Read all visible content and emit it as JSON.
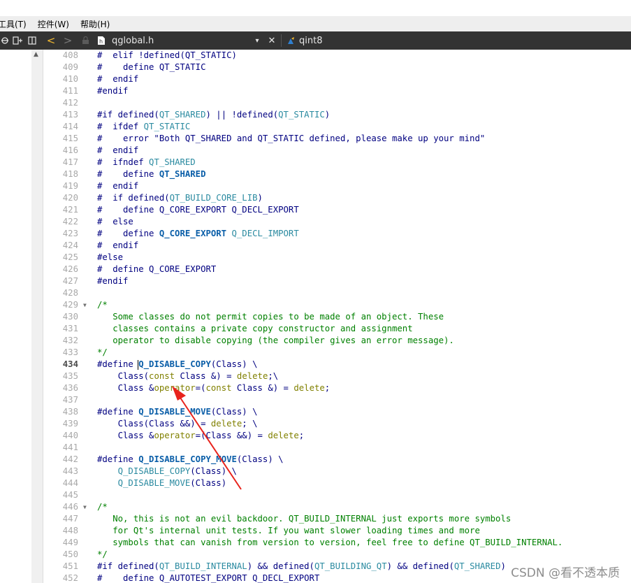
{
  "menu": [
    "工具(T)",
    "控件(W)",
    "帮助(H)"
  ],
  "toolbar": {
    "file_name": "qglobal.h",
    "symbol": "qint8",
    "back_glyph": "<",
    "forward_glyph": ">",
    "dropdown_glyph": "▾",
    "close_glyph": "✕"
  },
  "editor": {
    "current_line": 434,
    "lines": [
      {
        "n": "408",
        "t": [
          [
            "pp",
            "#  elif !defined(QT_STATIC)"
          ]
        ]
      },
      {
        "n": "409",
        "t": [
          [
            "pp",
            "#    define QT_STATIC"
          ]
        ]
      },
      {
        "n": "410",
        "t": [
          [
            "pp",
            "#  endif"
          ]
        ]
      },
      {
        "n": "411",
        "t": [
          [
            "pp",
            "#endif"
          ]
        ]
      },
      {
        "n": "412",
        "t": []
      },
      {
        "n": "413",
        "t": [
          [
            "pp",
            "#if defined("
          ],
          [
            "call",
            "QT_SHARED"
          ],
          [
            "pp",
            ") || !defined("
          ],
          [
            "call",
            "QT_STATIC"
          ],
          [
            "pp",
            ")"
          ]
        ]
      },
      {
        "n": "414",
        "t": [
          [
            "pp",
            "#  ifdef "
          ],
          [
            "call",
            "QT_STATIC"
          ]
        ]
      },
      {
        "n": "415",
        "t": [
          [
            "pp",
            "#    error \"Both QT_SHARED and QT_STATIC defined, please make up your mind\""
          ]
        ]
      },
      {
        "n": "416",
        "t": [
          [
            "pp",
            "#  endif"
          ]
        ]
      },
      {
        "n": "417",
        "t": [
          [
            "pp",
            "#  ifndef "
          ],
          [
            "call",
            "QT_SHARED"
          ]
        ]
      },
      {
        "n": "418",
        "t": [
          [
            "pp",
            "#    define "
          ],
          [
            "macro",
            "QT_SHARED"
          ]
        ]
      },
      {
        "n": "419",
        "t": [
          [
            "pp",
            "#  endif"
          ]
        ]
      },
      {
        "n": "420",
        "t": [
          [
            "pp",
            "#  if defined("
          ],
          [
            "call",
            "QT_BUILD_CORE_LIB"
          ],
          [
            "pp",
            ")"
          ]
        ]
      },
      {
        "n": "421",
        "t": [
          [
            "pp",
            "#    define Q_CORE_EXPORT Q_DECL_EXPORT"
          ]
        ]
      },
      {
        "n": "422",
        "t": [
          [
            "pp",
            "#  else"
          ]
        ]
      },
      {
        "n": "423",
        "t": [
          [
            "pp",
            "#    define "
          ],
          [
            "macro",
            "Q_CORE_EXPORT"
          ],
          [
            "pp",
            " "
          ],
          [
            "call",
            "Q_DECL_IMPORT"
          ]
        ]
      },
      {
        "n": "424",
        "t": [
          [
            "pp",
            "#  endif"
          ]
        ]
      },
      {
        "n": "425",
        "t": [
          [
            "pp",
            "#else"
          ]
        ]
      },
      {
        "n": "426",
        "t": [
          [
            "pp",
            "#  define Q_CORE_EXPORT"
          ]
        ]
      },
      {
        "n": "427",
        "t": [
          [
            "pp",
            "#endif"
          ]
        ]
      },
      {
        "n": "428",
        "t": []
      },
      {
        "n": "429",
        "f": true,
        "t": [
          [
            "comment",
            "/*"
          ]
        ]
      },
      {
        "n": "430",
        "t": [
          [
            "comment",
            "   Some classes do not permit copies to be made of an object. These"
          ]
        ]
      },
      {
        "n": "431",
        "t": [
          [
            "comment",
            "   classes contains a private copy constructor and assignment"
          ]
        ]
      },
      {
        "n": "432",
        "t": [
          [
            "comment",
            "   operator to disable copying (the compiler gives an error message)."
          ]
        ]
      },
      {
        "n": "433",
        "t": [
          [
            "comment",
            "*/"
          ]
        ]
      },
      {
        "n": "434",
        "t": [
          [
            "pp",
            "#define "
          ],
          [
            "caret",
            ""
          ],
          [
            "macro",
            "Q_DISABLE_COPY"
          ],
          [
            "pp",
            "(Class) \\"
          ]
        ]
      },
      {
        "n": "435",
        "t": [
          [
            "pp",
            "    Class("
          ],
          [
            "kw",
            "const"
          ],
          [
            "pp",
            " Class &) = "
          ],
          [
            "kw",
            "delete"
          ],
          [
            "pp",
            ";\\"
          ]
        ]
      },
      {
        "n": "436",
        "t": [
          [
            "pp",
            "    Class &"
          ],
          [
            "kw",
            "operator"
          ],
          [
            "pp",
            "=("
          ],
          [
            "kw",
            "const"
          ],
          [
            "pp",
            " Class &) = "
          ],
          [
            "kw",
            "delete"
          ],
          [
            "pp",
            ";"
          ]
        ]
      },
      {
        "n": "437",
        "t": []
      },
      {
        "n": "438",
        "t": [
          [
            "pp",
            "#define "
          ],
          [
            "macro",
            "Q_DISABLE_MOVE"
          ],
          [
            "pp",
            "(Class) \\"
          ]
        ]
      },
      {
        "n": "439",
        "t": [
          [
            "pp",
            "    Class(Class &&) = "
          ],
          [
            "kw",
            "delete"
          ],
          [
            "pp",
            "; \\"
          ]
        ]
      },
      {
        "n": "440",
        "t": [
          [
            "pp",
            "    Class &"
          ],
          [
            "kw",
            "operator"
          ],
          [
            "pp",
            "=(Class &&) = "
          ],
          [
            "kw",
            "delete"
          ],
          [
            "pp",
            ";"
          ]
        ]
      },
      {
        "n": "441",
        "t": []
      },
      {
        "n": "442",
        "t": [
          [
            "pp",
            "#define "
          ],
          [
            "macro",
            "Q_DISABLE_COPY_MOVE"
          ],
          [
            "pp",
            "(Class) \\"
          ]
        ]
      },
      {
        "n": "443",
        "t": [
          [
            "pp",
            "    "
          ],
          [
            "call",
            "Q_DISABLE_COPY"
          ],
          [
            "pp",
            "(Class) \\"
          ]
        ]
      },
      {
        "n": "444",
        "t": [
          [
            "pp",
            "    "
          ],
          [
            "call",
            "Q_DISABLE_MOVE"
          ],
          [
            "pp",
            "(Class)"
          ]
        ]
      },
      {
        "n": "445",
        "t": []
      },
      {
        "n": "446",
        "f": true,
        "t": [
          [
            "comment",
            "/*"
          ]
        ]
      },
      {
        "n": "447",
        "t": [
          [
            "comment",
            "   No, this is not an evil backdoor. QT_BUILD_INTERNAL just exports more symbols"
          ]
        ]
      },
      {
        "n": "448",
        "t": [
          [
            "comment",
            "   for Qt's internal unit tests. If you want slower loading times and more"
          ]
        ]
      },
      {
        "n": "449",
        "t": [
          [
            "comment",
            "   symbols that can vanish from version to version, feel free to define QT_BUILD_INTERNAL."
          ]
        ]
      },
      {
        "n": "450",
        "t": [
          [
            "comment",
            "*/"
          ]
        ]
      },
      {
        "n": "451",
        "t": [
          [
            "pp",
            "#if defined("
          ],
          [
            "call",
            "QT_BUILD_INTERNAL"
          ],
          [
            "pp",
            ") && defined("
          ],
          [
            "call",
            "QT_BUILDING_QT"
          ],
          [
            "pp",
            ") && defined("
          ],
          [
            "call",
            "QT_SHARED"
          ],
          [
            "pp",
            ")"
          ]
        ]
      },
      {
        "n": "452",
        "t": [
          [
            "pp",
            "#    define Q_AUTOTEST_EXPORT Q_DECL_EXPORT"
          ]
        ]
      }
    ]
  },
  "watermark": "CSDN @看不透本质",
  "colors": {
    "toolbar_bg": "#333333",
    "menubar_bg": "#eeeeee",
    "preprocessor": "#000080",
    "macro": "#0a5ea8",
    "comment": "#008000",
    "keyword": "#808000",
    "annotation_arrow": "#e8231c"
  }
}
